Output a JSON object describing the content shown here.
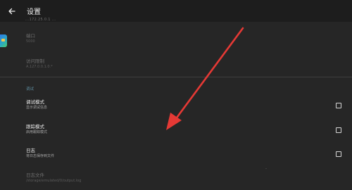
{
  "appbar": {
    "title": "设置"
  },
  "cut_text": "...172.25.0.1 ...",
  "port": {
    "label": "端口",
    "value": "5000"
  },
  "access_limit": {
    "label": "访问限制",
    "value": "A.127.0.0.1.0.*"
  },
  "debug_section": {
    "header": "调试",
    "items": [
      {
        "title": "调试模式",
        "subtitle": "显示调试信息",
        "checked": false
      },
      {
        "title": "跟踪模式",
        "subtitle": "启用跟踪模式",
        "checked": false
      },
      {
        "title": "日志",
        "subtitle": "将日志保存到文件",
        "checked": false
      }
    ]
  },
  "log_file": {
    "label": "日志文件",
    "path": "/storage/emulated/0/output.log"
  },
  "annotation": {
    "arrow_color": "#e53935"
  }
}
